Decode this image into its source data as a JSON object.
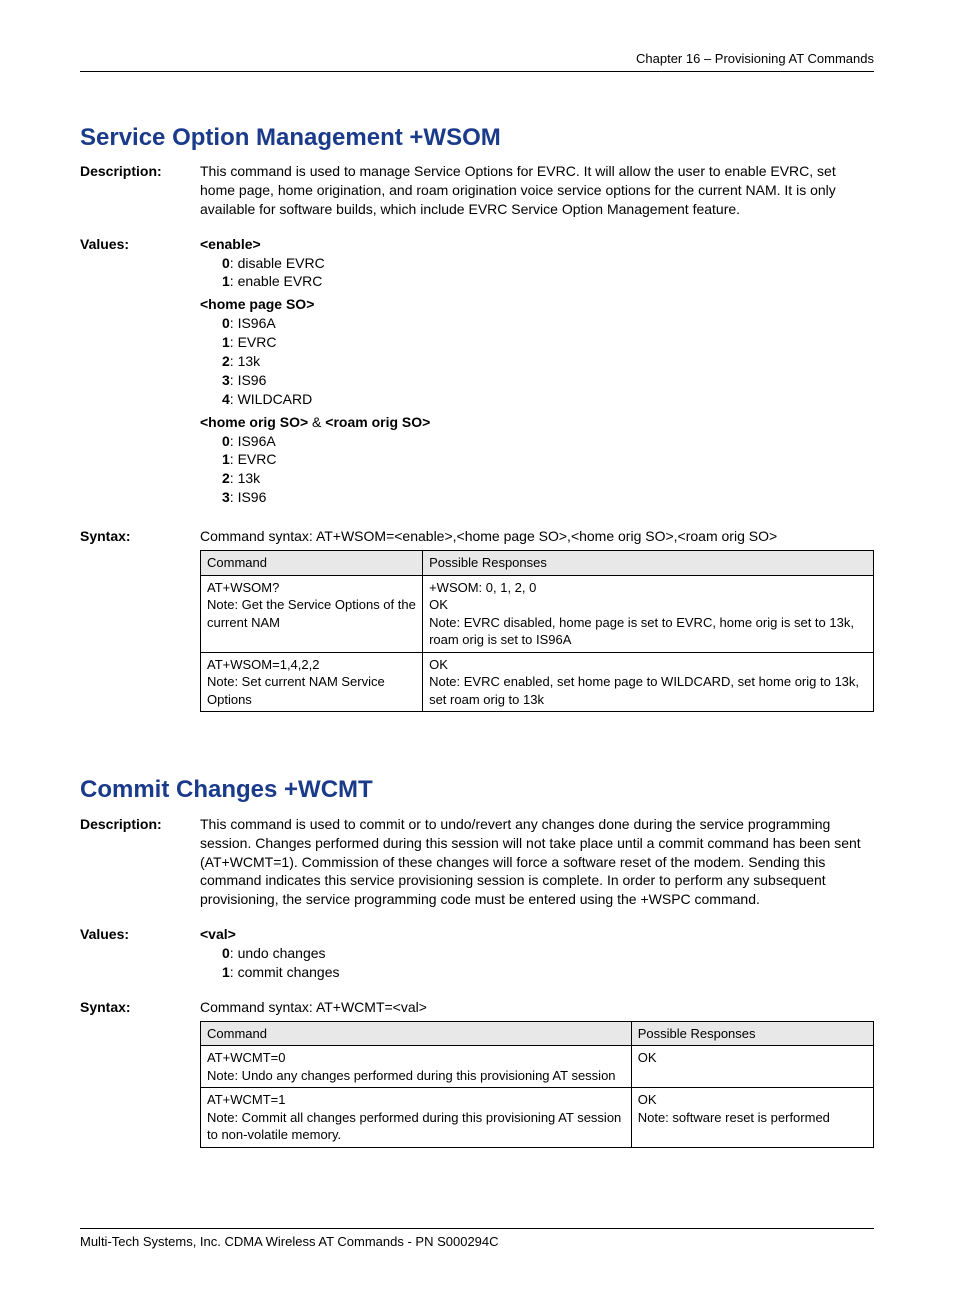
{
  "header": "Chapter 16 – Provisioning AT Commands",
  "footer": "Multi-Tech Systems, Inc. CDMA Wireless AT Commands - PN S000294C",
  "labels": {
    "description": "Description:",
    "values": "Values:",
    "syntax": "Syntax:",
    "command": "Command",
    "responses": "Possible Responses"
  },
  "s1": {
    "title": "Service Option Management  +WSOM",
    "description": "This command is used to manage Service Options for EVRC. It will allow the user to enable EVRC, set home page, home origination, and roam origination voice service options for the current NAM. It is only available for software builds, which include EVRC Service Option Management feature.",
    "values": {
      "g1": {
        "head": "<enable>",
        "items": [
          {
            "k": "0",
            "v": ": disable EVRC"
          },
          {
            "k": "1",
            "v": ": enable EVRC"
          }
        ]
      },
      "g2": {
        "head": "<home page SO>",
        "items": [
          {
            "k": "0",
            "v": ": IS96A"
          },
          {
            "k": "1",
            "v": ": EVRC"
          },
          {
            "k": "2",
            "v": ": 13k"
          },
          {
            "k": "3",
            "v": ": IS96"
          },
          {
            "k": "4",
            "v": ": WILDCARD"
          }
        ]
      },
      "g3": {
        "head_a": "<home orig SO>",
        "amp": " & ",
        "head_b": "<roam orig SO>",
        "items": [
          {
            "k": "0",
            "v": ": IS96A"
          },
          {
            "k": "1",
            "v": ": EVRC"
          },
          {
            "k": "2",
            "v": ": 13k"
          },
          {
            "k": "3",
            "v": ": IS96"
          }
        ]
      }
    },
    "syntax_text": "Command syntax: AT+WSOM=<enable>,<home page SO>,<home orig SO>,<roam orig SO>",
    "table": {
      "rows": [
        {
          "cmd": "AT+WSOM?\nNote: Get the Service Options of the current NAM",
          "resp": "+WSOM: 0, 1, 2, 0\nOK\nNote: EVRC disabled, home page is set to EVRC, home orig is set to 13k, roam orig is set to IS96A"
        },
        {
          "cmd": "AT+WSOM=1,4,2,2\nNote: Set current NAM Service Options",
          "resp": "OK\nNote: EVRC enabled, set home page to WILDCARD, set home orig to 13k, set roam orig to 13k"
        }
      ]
    }
  },
  "s2": {
    "title": "Commit Changes  +WCMT",
    "description": "This command is used to commit or to undo/revert any changes done during the service programming session. Changes performed during this session will not take place until a commit command has been sent (AT+WCMT=1). Commission of these changes will force a software reset of the modem. Sending this command indicates this service provisioning session is complete. In order to perform any subsequent provisioning, the service programming code must be entered using the +WSPC command.",
    "values": {
      "g1": {
        "head": "<val>",
        "items": [
          {
            "k": "0",
            "v": ": undo changes"
          },
          {
            "k": "1",
            "v": ": commit changes"
          }
        ]
      }
    },
    "syntax_text": "Command syntax: AT+WCMT=<val>",
    "table": {
      "rows": [
        {
          "cmd": "AT+WCMT=0\nNote: Undo any changes performed during this provisioning AT session",
          "resp": "OK"
        },
        {
          "cmd": "AT+WCMT=1\nNote: Commit all changes performed during this provisioning AT session to non-volatile memory.",
          "resp": "OK\nNote: software reset is performed"
        }
      ]
    }
  }
}
